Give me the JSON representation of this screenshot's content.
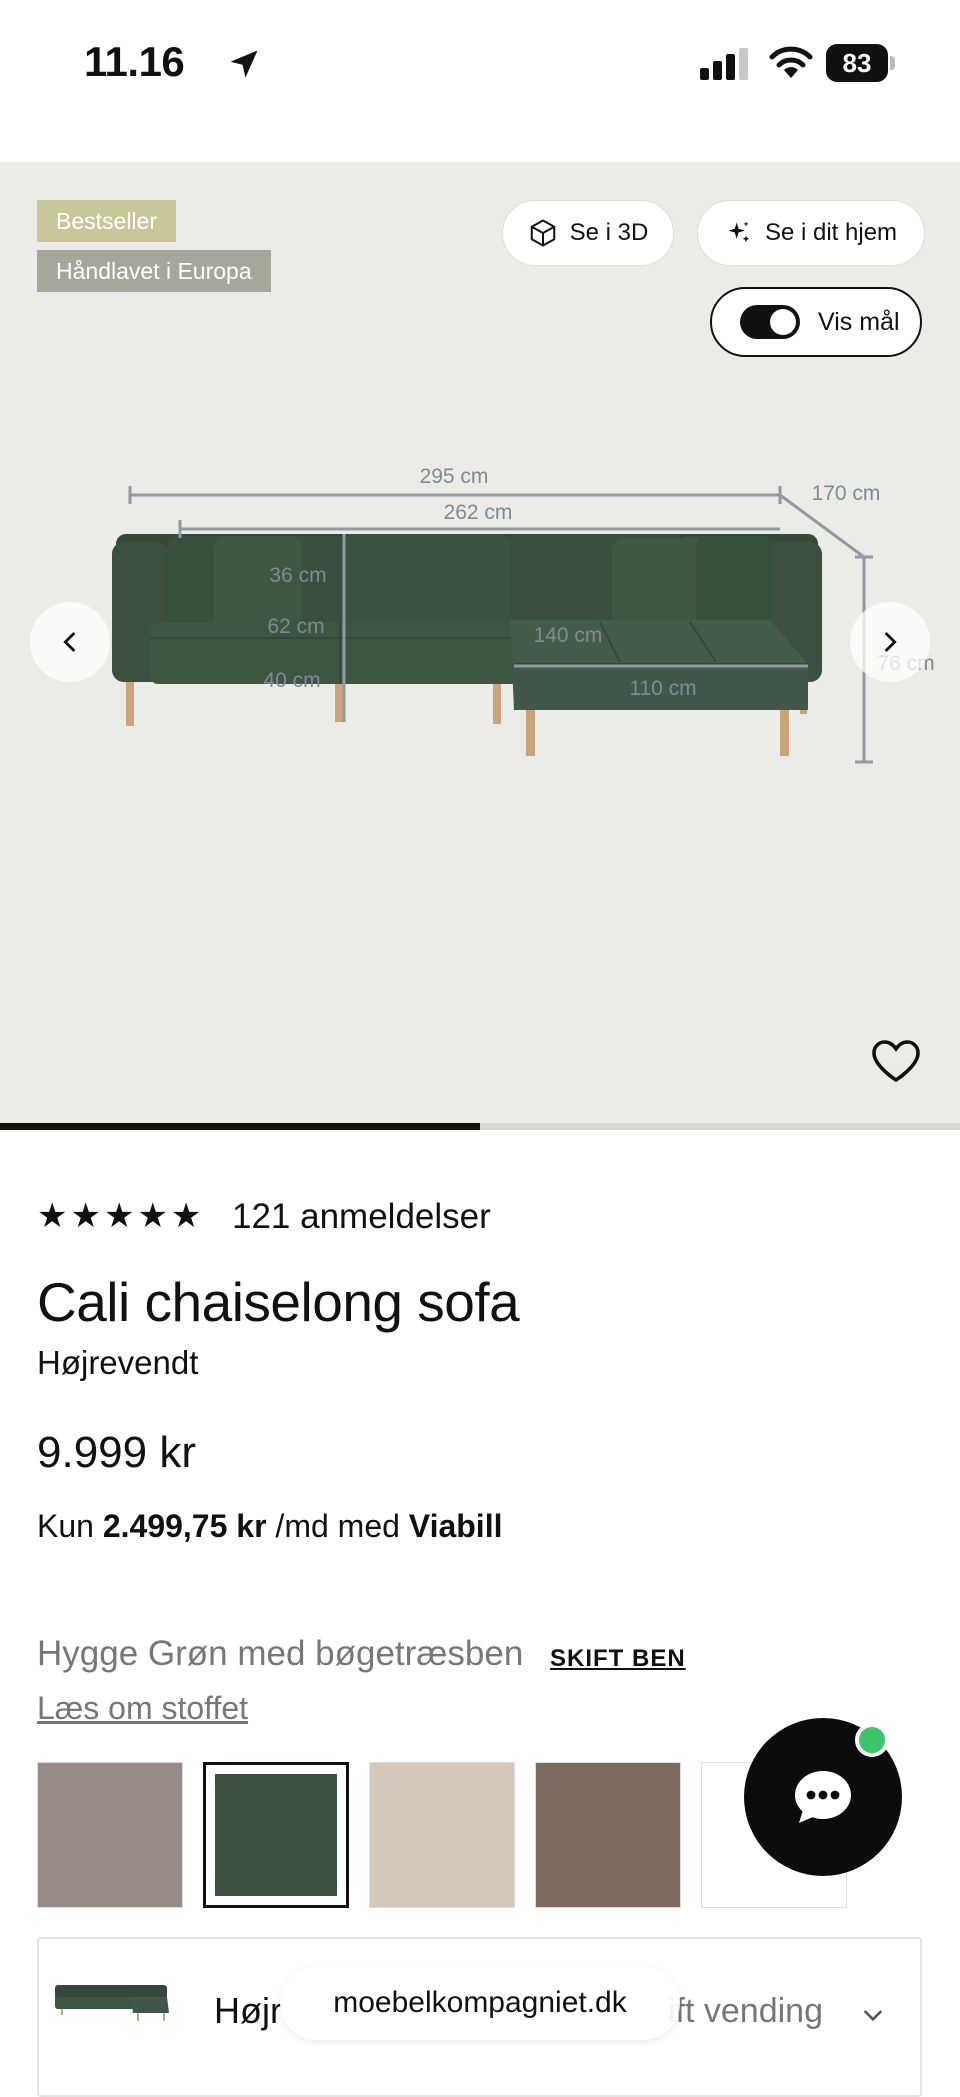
{
  "status_bar": {
    "time": "11.16",
    "battery": "83"
  },
  "hero": {
    "badges": [
      "Bestseller",
      "Håndlavet i Europa"
    ],
    "view_3d_label": "Se i 3D",
    "view_home_label": "Se i dit hjem",
    "show_dimensions_label": "Vis mål",
    "show_dimensions_on": true,
    "dimensions": {
      "total_width": "295 cm",
      "inner_width": "262 cm",
      "depth_chaise": "170 cm",
      "back_height": "36 cm",
      "seat_depth": "62 cm",
      "seat_height": "40 cm",
      "chaise_length": "140 cm",
      "chaise_width": "110 cm",
      "total_height": "76 cm"
    },
    "carousel_progress": 0.5
  },
  "product": {
    "stars": "★★★★★",
    "review_count": "121 anmeldelser",
    "title": "Cali chaiselong sofa",
    "variant": "Højrevendt",
    "price": "9.999 kr",
    "finance_prefix": "Kun",
    "finance_amount": "2.499,75 kr",
    "finance_mid": "/md med",
    "finance_provider": "Viabill",
    "color_name": "Hygge Grøn med bøgetræsben",
    "change_legs_label": "SKIFT BEN",
    "fabric_link": "Læs om stoffet",
    "swatches": [
      {
        "name": "grey-brown",
        "color": "#958b84"
      },
      {
        "name": "hygge-green",
        "color": "#3b503f",
        "selected": true
      },
      {
        "name": "sand",
        "color": "#d4c8bb"
      },
      {
        "name": "brown",
        "color": "#7c6a5f"
      },
      {
        "name": "white",
        "color": "#ffffff"
      }
    ],
    "orientation_label": "Højr",
    "orientation_action": "ift vending"
  },
  "browser": {
    "url": "moebelkompagniet.dk"
  },
  "colors": {
    "hero_bg": "#ebebe7",
    "sofa_green": "#3b503f",
    "dimension_line": "#8f9aa3",
    "chat_online": "#3ec46d"
  }
}
